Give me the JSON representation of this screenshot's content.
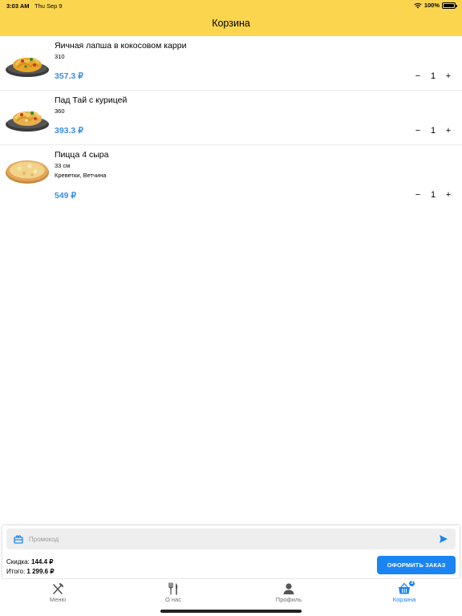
{
  "status": {
    "time": "3:03 AM",
    "date": "Thu Sep 9",
    "battery": "100%",
    "battery_level": 1.0
  },
  "header": {
    "title": "Корзина"
  },
  "cart": {
    "items": [
      {
        "name": "Яичная лапша в кокосовом карри",
        "size": "310",
        "extras": "",
        "price": "357.3 ₽",
        "quantity": "1",
        "image": "noodles-dish",
        "minus": "−",
        "plus": "+"
      },
      {
        "name": "Пад Тай с курицей",
        "size": "360",
        "extras": "",
        "price": "393.3 ₽",
        "quantity": "1",
        "image": "noodles-dish",
        "minus": "−",
        "plus": "+"
      },
      {
        "name": "Пицца 4 сыра",
        "size": "33 см",
        "extras": "Креветки, Ветчина",
        "price": "549 ₽",
        "quantity": "1",
        "image": "pizza",
        "minus": "−",
        "plus": "+"
      }
    ]
  },
  "checkout": {
    "promo_placeholder": "Промокод",
    "promo_value": "",
    "discount_label": "Скидка:",
    "discount_value": "144.4 ₽",
    "total_label": "Итого:",
    "total_value": "1 299.6 ₽",
    "order_button": "ОФОРМИТЬ ЗАКАЗ"
  },
  "tabbar": {
    "tabs": [
      {
        "label": "Меню",
        "icon": "fork-knife-cross-icon",
        "active": false
      },
      {
        "label": "О нас",
        "icon": "fork-knife-icon",
        "active": false
      },
      {
        "label": "Профиль",
        "icon": "person-icon",
        "active": false
      },
      {
        "label": "Корзина",
        "icon": "basket-icon",
        "active": true,
        "badge": "3"
      }
    ]
  },
  "colors": {
    "header": "#FCD54E",
    "accent": "#1A84F2",
    "price": "#3B8DE8",
    "inactive_tab": "#707070"
  }
}
